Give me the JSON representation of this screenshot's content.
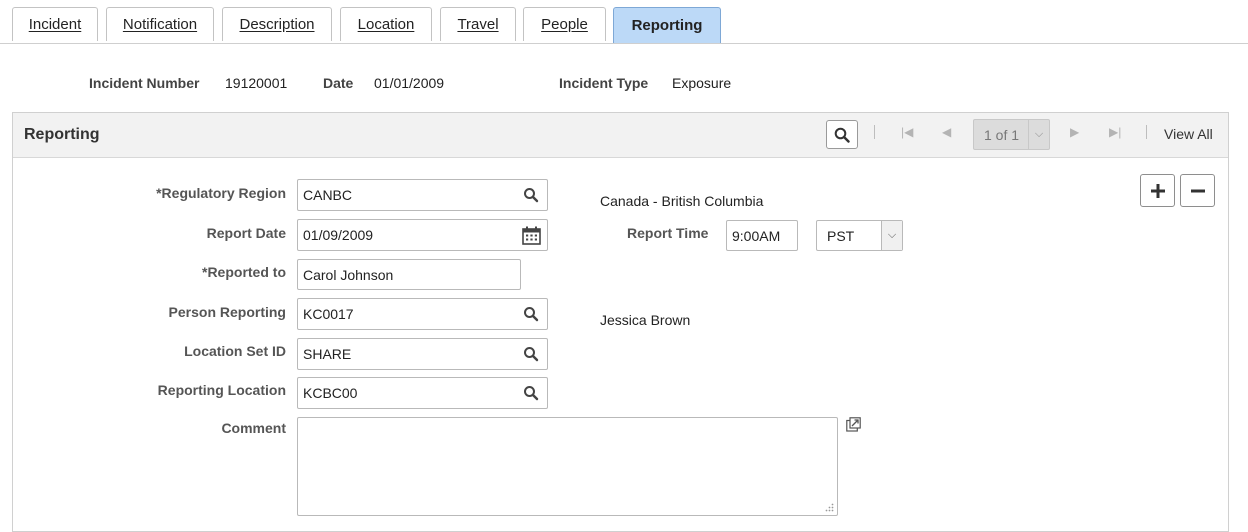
{
  "tabs": [
    {
      "label": "Incident",
      "active": false
    },
    {
      "label": "Notification",
      "active": false
    },
    {
      "label": "Description",
      "active": false
    },
    {
      "label": "Location",
      "active": false
    },
    {
      "label": "Travel",
      "active": false
    },
    {
      "label": "People",
      "active": false
    },
    {
      "label": "Reporting",
      "active": true
    }
  ],
  "header": {
    "incident_number_label": "Incident Number",
    "incident_number": "19120001",
    "date_label": "Date",
    "date": "01/01/2009",
    "incident_type_label": "Incident Type",
    "incident_type": "Exposure"
  },
  "panel": {
    "title": "Reporting",
    "pager": "1 of 1",
    "view_all": "View All",
    "icons": [
      "search-icon",
      "first-icon",
      "previous-icon",
      "next-icon",
      "last-icon",
      "add-row-icon",
      "delete-row-icon"
    ]
  },
  "form": {
    "regulatory_region_label": "*Regulatory Region",
    "regulatory_region": "CANBC",
    "regulatory_region_desc": "Canada - British Columbia",
    "report_date_label": "Report Date",
    "report_date": "01/09/2009",
    "report_time_label": "Report Time",
    "report_time": "9:00AM",
    "time_zone": "PST",
    "reported_to_label": "*Reported to",
    "reported_to": "Carol Johnson",
    "person_reporting_label": "Person Reporting",
    "person_reporting": "KC0017",
    "person_reporting_name": "Jessica Brown",
    "location_set_id_label": "Location Set ID",
    "location_set_id": "SHARE",
    "reporting_location_label": "Reporting Location",
    "reporting_location": "KCBC00",
    "comment_label": "Comment",
    "comment": ""
  },
  "colors": {
    "active_tab": "#bcd9f7",
    "panel_header": "#f2f2f2",
    "border": "#b9b9b9"
  }
}
